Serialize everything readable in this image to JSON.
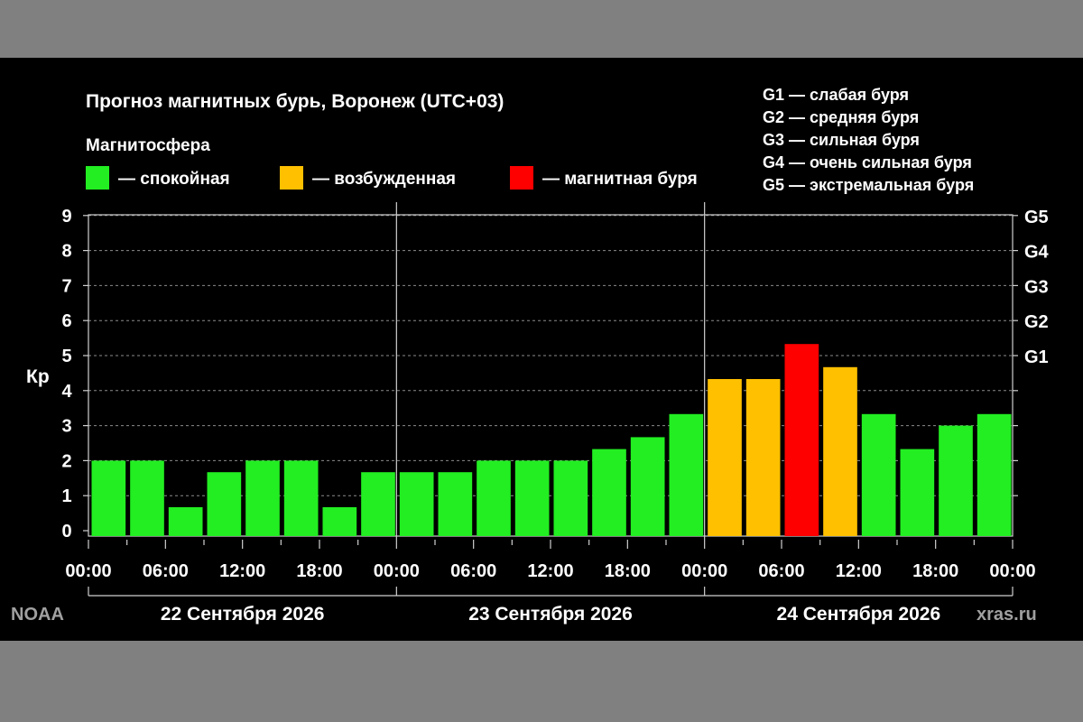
{
  "chart_data": {
    "type": "bar",
    "title": "Прогноз магнитных бурь, Воронеж (UTC+03)",
    "legend_title": "Магнитосфера",
    "legend": [
      {
        "label": "— спокойная",
        "color": "#22ee22"
      },
      {
        "label": "— возбужденная",
        "color": "#ffc000"
      },
      {
        "label": "— магнитная буря",
        "color": "#ff0000"
      }
    ],
    "g_scale_legend": [
      "G1 — слабая буря",
      "G2 — средняя буря",
      "G3 — сильная буря",
      "G4 — очень сильная буря",
      "G5 — экстремальная буря"
    ],
    "ylabel": "Кр",
    "ylim": [
      0,
      9
    ],
    "y_ticks": [
      "0",
      "1",
      "2",
      "3",
      "4",
      "5",
      "6",
      "7",
      "8",
      "9"
    ],
    "right_ticks": [
      {
        "label": "G1",
        "value": 5
      },
      {
        "label": "G2",
        "value": 6
      },
      {
        "label": "G3",
        "value": 7
      },
      {
        "label": "G4",
        "value": 8
      },
      {
        "label": "G5",
        "value": 9
      }
    ],
    "grid": true,
    "x_ticks": [
      "00:00",
      "06:00",
      "12:00",
      "18:00",
      "00:00",
      "06:00",
      "12:00",
      "18:00",
      "00:00",
      "06:00",
      "12:00",
      "18:00",
      "00:00"
    ],
    "days": [
      "22 Сентября 2026",
      "23 Сентября 2026",
      "24 Сентября 2026"
    ],
    "values": [
      2.0,
      2.0,
      0.67,
      1.67,
      2.0,
      2.0,
      0.67,
      1.67,
      1.67,
      1.67,
      2.0,
      2.0,
      2.0,
      2.33,
      2.67,
      3.33,
      4.33,
      4.33,
      5.33,
      4.67,
      3.33,
      2.33,
      3.0,
      3.33
    ],
    "colors": {
      "quiet": "#22ee22",
      "active": "#ffc000",
      "storm": "#ff0000"
    },
    "source_left": "NOAA",
    "source_right": "xras.ru"
  }
}
